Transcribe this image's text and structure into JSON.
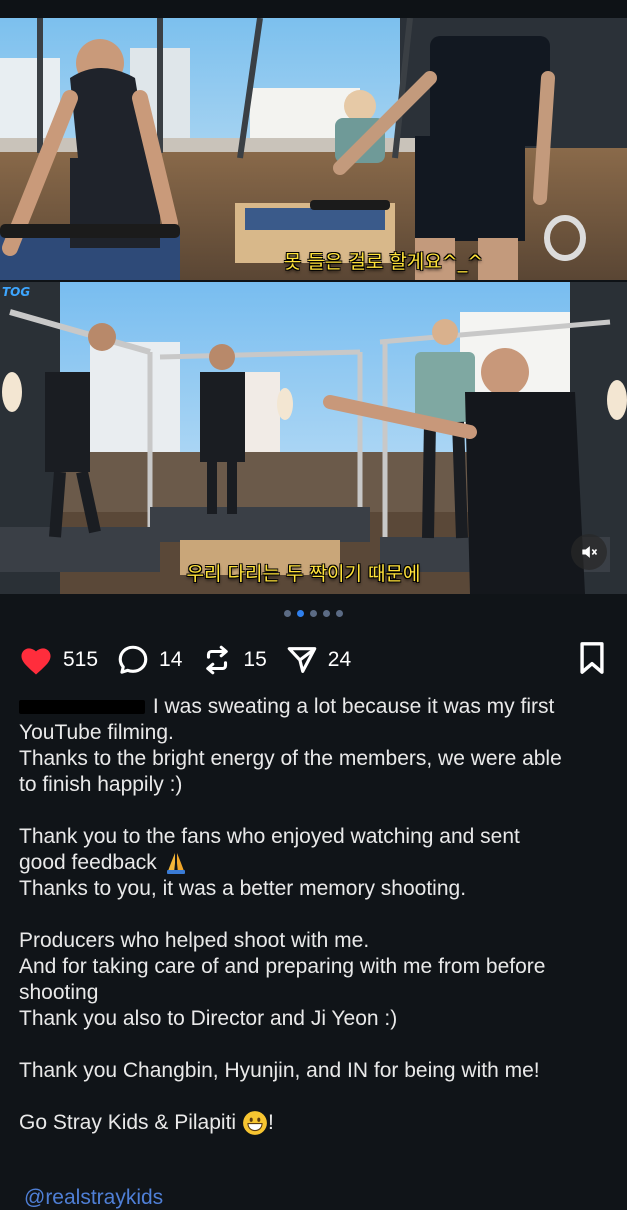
{
  "media": {
    "frame1_caption": "못 들은 걸로 할게요^_^",
    "frame2_caption": "우리 다리는 두 짝이기 때문에",
    "frame2_corner_label": "TOG",
    "mute_icon": "speaker-muted-icon",
    "carousel": {
      "count": 5,
      "active_index": 1
    }
  },
  "actions": {
    "likes": "515",
    "comments": "14",
    "reposts": "15",
    "shares": "24",
    "like_color": "#ff2d3c"
  },
  "post": {
    "lines": [
      "I was sweating a lot because it was my first",
      "YouTube filming.",
      "Thanks to the bright energy of the members, we were able",
      "to finish happily :)",
      "Thank you to the fans who enjoyed watching and sent",
      "good feedback",
      "Thanks to you, it was a better memory shooting.",
      "Producers who helped shoot with me.",
      "And for taking care of and preparing with me from before",
      "shooting",
      "Thank you also to Director and Ji Yeon :)",
      "Thank you Changbin, Hyunjin, and IN for being with me!",
      "Go Stray Kids & Pilapiti",
      "!"
    ],
    "mention": "@realstraykids"
  }
}
